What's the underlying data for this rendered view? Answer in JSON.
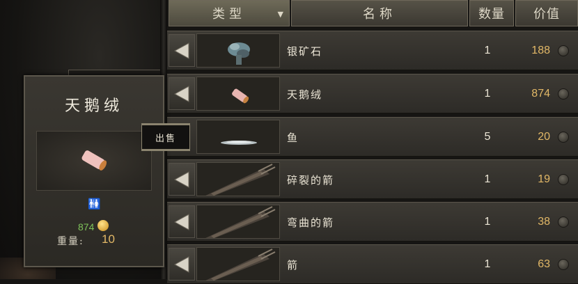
{
  "header": {
    "type_label": "类型",
    "name_label": "名称",
    "qty_label": "数量",
    "value_label": "价值"
  },
  "items": [
    {
      "name": "银矿石",
      "qty": "1",
      "value": "188",
      "icon": "silver-ore-icon"
    },
    {
      "name": "天鹅绒",
      "qty": "1",
      "value": "874",
      "icon": "velvet-icon"
    },
    {
      "name": "鱼",
      "qty": "5",
      "value": "20",
      "icon": "fish-icon"
    },
    {
      "name": "碎裂的箭",
      "qty": "1",
      "value": "19",
      "icon": "arrows-icon"
    },
    {
      "name": "弯曲的箭",
      "qty": "1",
      "value": "38",
      "icon": "arrows-icon"
    },
    {
      "name": "箭",
      "qty": "1",
      "value": "63",
      "icon": "arrows-icon"
    }
  ],
  "tooltip": {
    "title": "天鹅绒",
    "price": "874",
    "weight_label": "重量:",
    "weight": "10"
  },
  "sell_button": {
    "label": "出售"
  },
  "colors": {
    "value": "#e2b867",
    "price": "#7fc35a",
    "panel": "#3a3731"
  }
}
